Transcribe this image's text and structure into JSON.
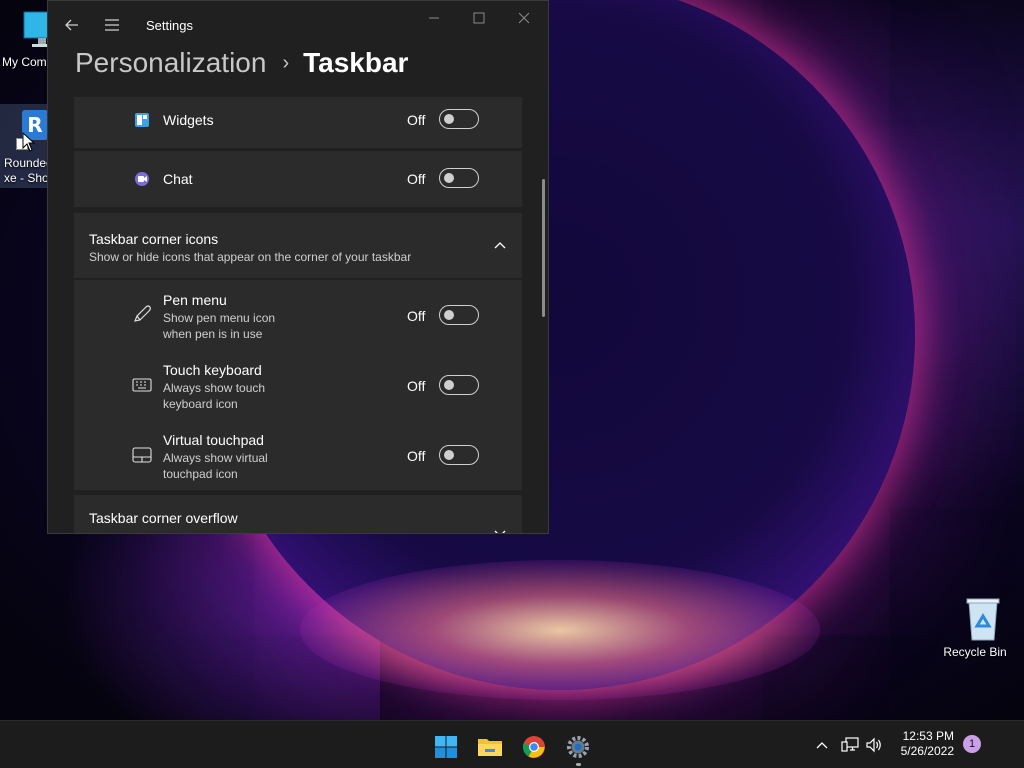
{
  "desktop": {
    "icons": [
      {
        "label": "My Com"
      },
      {
        "label_line1": "Roundec",
        "label_line2": "xe - Sho",
        "badge": "R"
      },
      {
        "label": "Recycle Bin"
      }
    ]
  },
  "settings": {
    "app_title": "Settings",
    "breadcrumb": {
      "parent": "Personalization",
      "separator": "›",
      "current": "Taskbar"
    },
    "rows": {
      "widgets": {
        "title": "Widgets",
        "state": "Off",
        "on": false
      },
      "chat": {
        "title": "Chat",
        "state": "Off",
        "on": false
      },
      "corner_icons": {
        "title": "Taskbar corner icons",
        "subtitle": "Show or hide icons that appear on the corner of your taskbar",
        "expanded": true
      },
      "pen_menu": {
        "title": "Pen menu",
        "sub1": "Show pen menu icon",
        "sub2": "when pen is in use",
        "state": "Off",
        "on": false
      },
      "touch_keyboard": {
        "title": "Touch keyboard",
        "sub1": "Always show touch",
        "sub2": "keyboard icon",
        "state": "Off",
        "on": false
      },
      "virtual_touchpad": {
        "title": "Virtual touchpad",
        "sub1": "Always show virtual",
        "sub2": "touchpad icon",
        "state": "Off",
        "on": false
      },
      "corner_overflow": {
        "title": "Taskbar corner overflow",
        "expanded": false
      }
    }
  },
  "taskbar": {
    "apps": [
      "start-icon",
      "file-explorer-icon",
      "chrome-icon",
      "settings-icon"
    ],
    "tray": [
      "chevron-up-icon",
      "network-icon",
      "volume-icon"
    ],
    "time": "12:53 PM",
    "date": "5/26/2022",
    "notification_count": "1"
  },
  "colors": {
    "accent": "#4cc2ff",
    "card": "#2b2b2b",
    "window": "#202020"
  }
}
